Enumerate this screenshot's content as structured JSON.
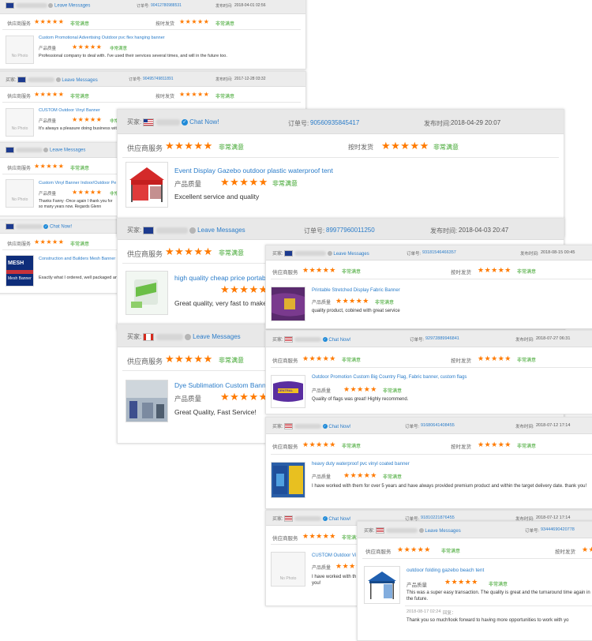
{
  "common": {
    "buyer_label": "买家:",
    "supplier_service": "供应商服务",
    "on_time_delivery": "按时发货",
    "product_quality": "产品质量",
    "very_satisfied": "非常满意",
    "order_no_label": "订单号:",
    "time_label": "发布时间:",
    "chat_now": "Chat Now!",
    "leave_messages": "Leave Messages",
    "stars": "★★★★★",
    "no_photo": "No Photo"
  },
  "reviews": [
    {
      "order": "90412780988531",
      "time": "2018-04-01 02:56",
      "contact": "Leave Messages",
      "flag": "au",
      "product": "Custom Promotional Advertising Outdoor pvc flex hanging banner",
      "comment": "Professional company to deal with. I've used their services several times, and will in the future too."
    },
    {
      "order": "90495749811891",
      "time": "2017-12-28 03:32",
      "contact": "Leave Messages",
      "flag": "au",
      "product": "CUSTOM Outdoor Vinyl Banner",
      "comment": "It's always a pleasure doing business with"
    },
    {
      "order": "",
      "time": "",
      "contact": "Leave Messages",
      "flag": "au",
      "product": "Custom Vinyl Banner Indoor/Outdoor Pe",
      "comment": "Thanks Fanny -Once again I thank you for so many years now. Regards Glenn"
    },
    {
      "order": "",
      "time": "",
      "contact": "Chat Now!",
      "flag": "au",
      "product": "Construction and Builders Mesh Banner",
      "comment": "Exactly what I ordered, well packaged and"
    },
    {
      "order": "90560935845417",
      "time": "2018-04-29 20:07",
      "contact": "Chat Now!",
      "flag": "us",
      "product": "Event Display Gazebo outdoor plastic waterproof tent",
      "comment": "Excellent service and quality"
    },
    {
      "order": "89977960011250",
      "time": "2018-04-03 20:47",
      "contact": "Leave Messages",
      "flag": "au",
      "product": "high quality cheap price portable",
      "comment": "Great quality, very fast to make ar"
    },
    {
      "order": "",
      "time": "",
      "contact": "Leave Messages",
      "flag": "ca",
      "product": "Dye Sublimation Custom Banner",
      "comment": "Great Quality, Fast Service!"
    },
    {
      "order": "93181546466357",
      "time": "2018-08-15 00:45",
      "contact": "Leave Messages",
      "flag": "au",
      "product": "Printable Stretched Display Fabric Banner",
      "comment": "quality product, cobined with great service"
    },
    {
      "order": "92972889946841",
      "time": "2018-07-27 06:31",
      "contact": "Chat Now!",
      "flag": "us",
      "product": "Outdoor Promotion Custom Big Country Flag, Fabric banner, custom flags",
      "comment": "Quality of flags was great! Highly recommend."
    },
    {
      "order": "91680641408455",
      "time": "2018-07-12 17:14",
      "contact": "Chat Now!",
      "flag": "us",
      "product": "heavy duty waterproof pvc vinyl coated banner",
      "comment": "I have worked with them for over 5 years and have always provided premium product and within the target delivery date. thank you!"
    },
    {
      "order": "91810221876455",
      "time": "2018-07-12 17:14",
      "contact": "Chat Now!",
      "flag": "us",
      "product": "CUSTOM Outdoor Vi",
      "comment": "I have worked with th you!"
    },
    {
      "order": "93444690420778",
      "time": "",
      "contact": "Leave Messages",
      "flag": "us",
      "product": "outdoor folding gazebo beach tent",
      "comment": "This was a super easy transaction. The quality is great and the turnaround time again in the future.",
      "followup_time": "2018-08-17 02:24",
      "followup_label": "回复：",
      "followup": "Thank you so much!look forward to having more opportunities to work with yo"
    }
  ],
  "thumb_texts": {
    "mesh": "MESH\nBanner",
    "central": "CENTRAL"
  }
}
